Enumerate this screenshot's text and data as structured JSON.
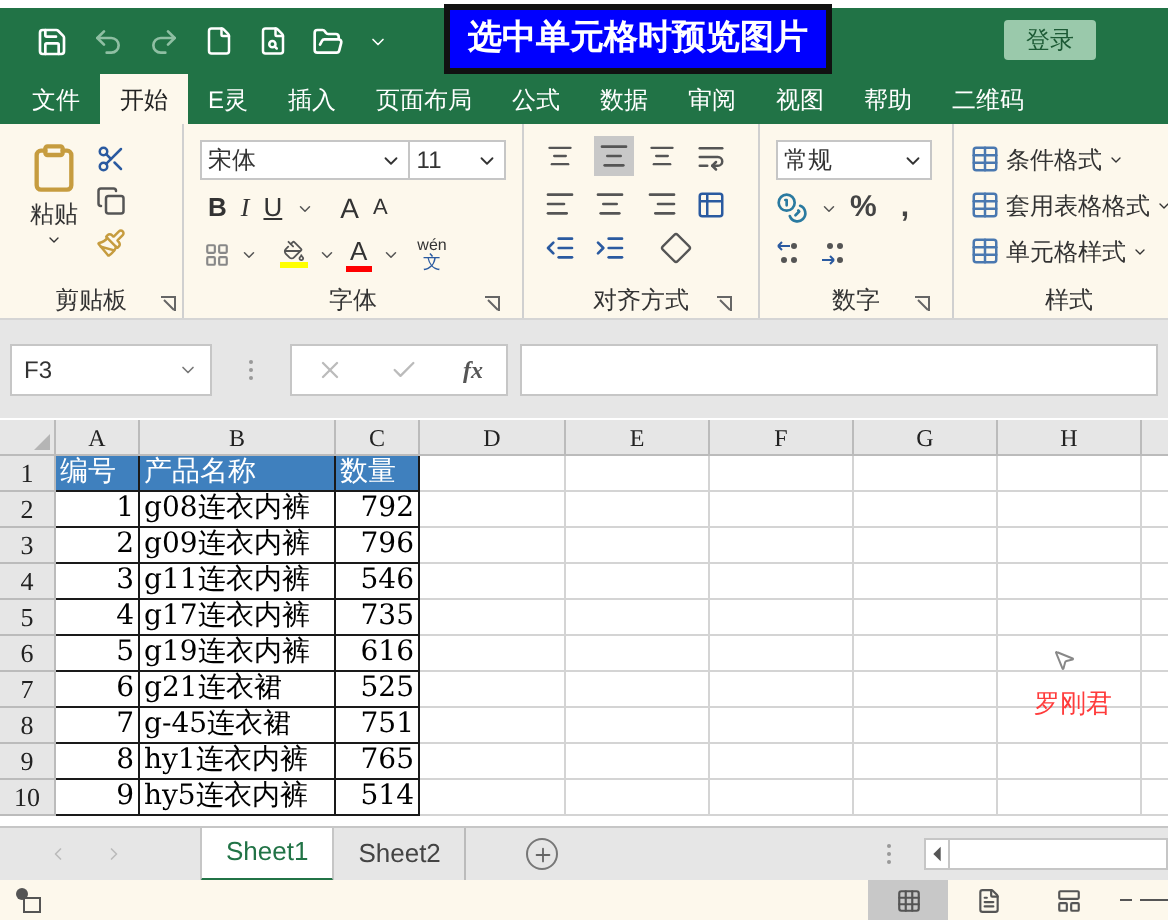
{
  "title_overlay": "选中单元格时预览图片",
  "login_button": "登录",
  "tabs": [
    {
      "label": "文件",
      "selected": false
    },
    {
      "label": "开始",
      "selected": true
    },
    {
      "label": "E灵",
      "selected": false
    },
    {
      "label": "插入",
      "selected": false
    },
    {
      "label": "页面布局",
      "selected": false
    },
    {
      "label": "公式",
      "selected": false
    },
    {
      "label": "数据",
      "selected": false
    },
    {
      "label": "审阅",
      "selected": false
    },
    {
      "label": "视图",
      "selected": false
    },
    {
      "label": "帮助",
      "selected": false
    },
    {
      "label": "二维码",
      "selected": false
    }
  ],
  "ribbon": {
    "clipboard": {
      "paste": "粘贴",
      "label": "剪贴板"
    },
    "font": {
      "font_name": "宋体",
      "font_size": "11",
      "bold": "B",
      "italic": "I",
      "underline": "U",
      "grow": "A",
      "shrink": "A",
      "font_color": "A",
      "phonetic_top": "wén",
      "phonetic_bottom": "文",
      "label": "字体"
    },
    "alignment": {
      "label": "对齐方式"
    },
    "number": {
      "format": "常规",
      "percent": "%",
      "comma": ",",
      "label": "数字"
    },
    "styles": {
      "items": [
        "条件格式",
        "套用表格格式",
        "单元格样式"
      ],
      "label": "样式"
    }
  },
  "name_box": "F3",
  "fx": "fx",
  "sheet": {
    "columns": [
      "A",
      "B",
      "C",
      "D",
      "E",
      "F",
      "G",
      "H"
    ],
    "rows": [
      {
        "number": "1",
        "header": true,
        "cells": [
          "编号",
          "产品名称",
          "数量"
        ]
      },
      {
        "number": "2",
        "header": false,
        "cells": [
          "1",
          "g08连衣内裤",
          "792"
        ]
      },
      {
        "number": "3",
        "header": false,
        "cells": [
          "2",
          "g09连衣内裤",
          "796"
        ]
      },
      {
        "number": "4",
        "header": false,
        "cells": [
          "3",
          "g11连衣内裤",
          "546"
        ]
      },
      {
        "number": "5",
        "header": false,
        "cells": [
          "4",
          "g17连衣内裤",
          "735"
        ]
      },
      {
        "number": "6",
        "header": false,
        "cells": [
          "5",
          "g19连衣内裤",
          "616"
        ]
      },
      {
        "number": "7",
        "header": false,
        "cells": [
          "6",
          "g21连衣裙",
          "525"
        ]
      },
      {
        "number": "8",
        "header": false,
        "cells": [
          "7",
          "g-45连衣裙",
          "751"
        ]
      },
      {
        "number": "9",
        "header": false,
        "cells": [
          "8",
          "hy1连衣内裤",
          "765"
        ]
      },
      {
        "number": "10",
        "header": false,
        "cells": [
          "9",
          "hy5连衣内裤",
          "514"
        ]
      }
    ],
    "signature": "罗刚君"
  },
  "sheet_tabs": [
    {
      "label": "Sheet1",
      "selected": true
    },
    {
      "label": "Sheet2",
      "selected": false
    }
  ]
}
